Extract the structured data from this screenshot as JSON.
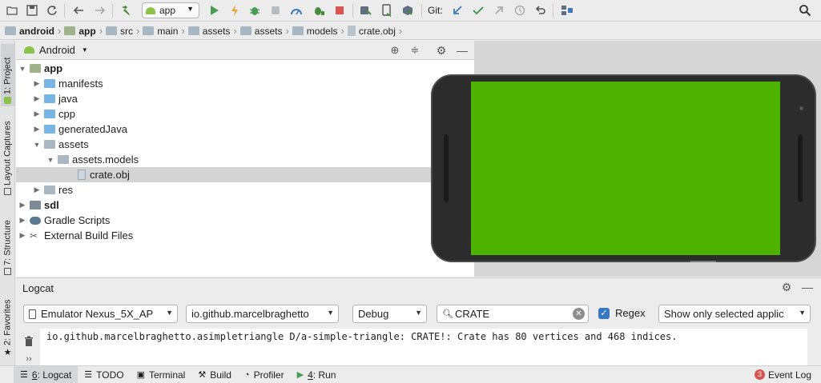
{
  "toolbar": {
    "run_config": "app",
    "git_label": "Git:",
    "icons": [
      "open-icon",
      "save-icon",
      "sync-icon",
      "back-icon",
      "forward-icon",
      "build-icon",
      "run-icon",
      "apply-changes-icon",
      "debug-icon",
      "attach-debugger-icon",
      "profile-icon",
      "coverage-icon",
      "stop-icon",
      "avd-manager-icon",
      "device-file-icon",
      "sdk-manager-icon",
      "git-update-icon",
      "git-commit-icon",
      "git-push-icon",
      "git-history-icon",
      "git-revert-icon",
      "project-structure-icon",
      "search-icon"
    ]
  },
  "breadcrumb": [
    {
      "label": "android",
      "bold": true,
      "type": "folder"
    },
    {
      "label": "app",
      "bold": true,
      "type": "folder"
    },
    {
      "label": "src",
      "bold": false,
      "type": "folder"
    },
    {
      "label": "main",
      "bold": false,
      "type": "folder"
    },
    {
      "label": "assets",
      "bold": false,
      "type": "folder"
    },
    {
      "label": "assets",
      "bold": false,
      "type": "folder"
    },
    {
      "label": "models",
      "bold": false,
      "type": "folder"
    },
    {
      "label": "crate.obj",
      "bold": false,
      "type": "file"
    }
  ],
  "left_stripe": {
    "project": "1: Project",
    "layout_captures": "Layout Captures",
    "structure": "7: Structure",
    "favorites": "2: Favorites"
  },
  "project": {
    "view": "Android",
    "tree": [
      {
        "label": "app",
        "bold": true,
        "level": 0,
        "expanded": true
      },
      {
        "label": "manifests",
        "bold": false,
        "level": 1,
        "expanded": false
      },
      {
        "label": "java",
        "bold": false,
        "level": 1,
        "expanded": false
      },
      {
        "label": "cpp",
        "bold": false,
        "level": 1,
        "expanded": false
      },
      {
        "label": "generatedJava",
        "bold": false,
        "level": 1,
        "expanded": false
      },
      {
        "label": "assets",
        "bold": false,
        "level": 1,
        "expanded": true
      },
      {
        "label": "assets.models",
        "bold": false,
        "level": 2,
        "expanded": true
      },
      {
        "label": "crate.obj",
        "bold": false,
        "level": 3,
        "selected": true
      },
      {
        "label": "res",
        "bold": false,
        "level": 1,
        "expanded": false
      },
      {
        "label": "sdl",
        "bold": true,
        "level": 0,
        "expanded": false
      },
      {
        "label": "Gradle Scripts",
        "bold": false,
        "level": 0,
        "expanded": false
      },
      {
        "label": "External Build Files",
        "bold": false,
        "level": 0,
        "expanded": false
      }
    ]
  },
  "emulator": {
    "screen_color": "#4db200"
  },
  "logcat": {
    "title": "Logcat",
    "device": "Emulator Nexus_5X_AP",
    "process": "io.github.marcelbraghetto",
    "level": "Debug",
    "search": "CRATE",
    "regex_label": "Regex",
    "regex_checked": true,
    "filter": "Show only selected applic",
    "lines": [
      "io.github.marcelbraghetto.asimpletriangle D/a-simple-triangle: CRATE!: Crate has 80 vertices and 468 indices."
    ]
  },
  "bottom_bar": {
    "logcat_key": "6",
    "logcat": ": Logcat",
    "todo": "TODO",
    "terminal": "Terminal",
    "build": "Build",
    "profiler": "Profiler",
    "run_key": "4",
    "run": ": Run",
    "event_log_count": "3",
    "event_log": "Event Log"
  }
}
